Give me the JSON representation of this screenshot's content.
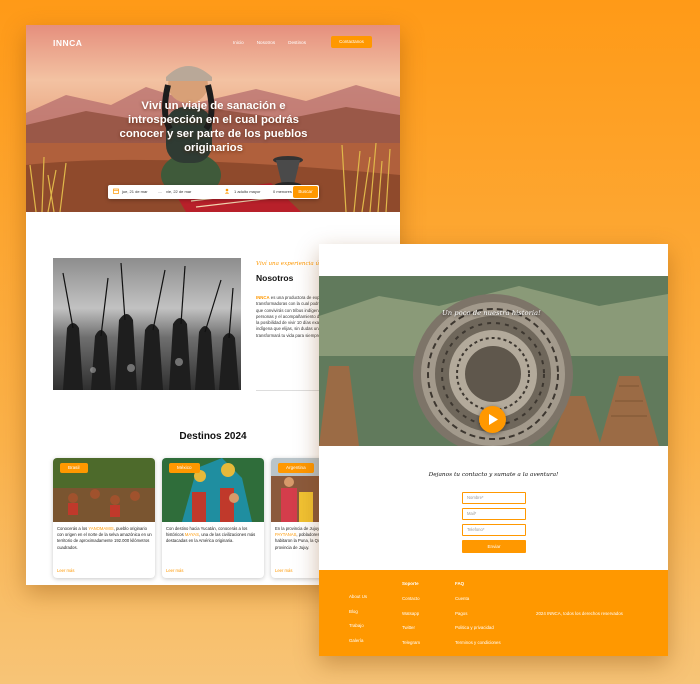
{
  "colors": {
    "accent": "#ff9800",
    "background": "#ff9a17",
    "text": "#111111"
  },
  "header": {
    "logo": "INNCA",
    "nav": [
      "Inicio",
      "Nosotros",
      "Destinos"
    ],
    "cta": "Contactanos"
  },
  "hero": {
    "title": "Viví un viaje de sanación e introspección en el cual podrás conocer y ser parte de los pueblos originarios",
    "search": {
      "date_from": "jue, 21 de mar",
      "date_to": "vie, 22 de mar",
      "guests": "1 adulto mayor",
      "minors": "0 menores",
      "button": "Buscar",
      "icons": [
        "calendar-icon",
        "user-icon"
      ]
    }
  },
  "about": {
    "tagline": "Viví una experiencia única!",
    "title": "Nosotros",
    "brand": "INNCA",
    "text": " es una productora de experiencias únicas y transformadoras con la cual podrás emprender un viaje en el que convivirás con tribus indígenas junto con otras 5 personas y el acompañamiento de 2 coordinadores. Tendrás la posibilidad de vivir 10 días exactamente igual que el pueblo indígena que elijas, sin dudas una experiencia que transformará tu vida para siempre."
  },
  "destinations": {
    "title": "Destinos 2024",
    "cards": [
      {
        "badge": "Brasil",
        "pre": "Conocerás a los ",
        "highlight": "YANOMAMIS",
        "post": ", pueblo originario con origen en el norte de la selva amazónica en un territorio de aproximadamente 192.000 kilómetros cuadrados.",
        "link": "Leer más"
      },
      {
        "badge": "México",
        "pre": "Con destino hacia Yucatán, conocerás a los históricos ",
        "highlight": "MAYAS",
        "post": ", una de las civilizaciones más destacadas en la América originaria.",
        "link": "Leer más"
      },
      {
        "badge": "Argentina",
        "pre": "En la provincia de Jujuy vas a encontrar a los ",
        "highlight": "PAYTANAS",
        "post": ", pobladores prehispánicos que habitaron la Puna, la Quebrada y los Valles de la provincia de Jujuy.",
        "link": "Leer más"
      }
    ]
  },
  "story": {
    "title": "Un poco de nuestra historia!",
    "play_icon": "play-icon"
  },
  "contact": {
    "title": "Dejanos tu contacto y sumate a la aventura!",
    "fields": [
      "Nombre*",
      "Mail*",
      "Telefono*"
    ],
    "button": "Enviar"
  },
  "footer": {
    "columns": [
      {
        "heading": "",
        "links": [
          "About Us",
          "Blog",
          "Trabajo",
          "Galería"
        ]
      },
      {
        "heading": "Soporte",
        "links": [
          "Contacto",
          "Watsapp",
          "Twitter",
          "Telegram"
        ]
      },
      {
        "heading": "FAQ",
        "links": [
          "Cuenta",
          "Pagos",
          "Politica y privacidad",
          "Terminos y condiciones"
        ]
      }
    ],
    "copyright": "2024 INNCA, todos los derechos reservados"
  }
}
